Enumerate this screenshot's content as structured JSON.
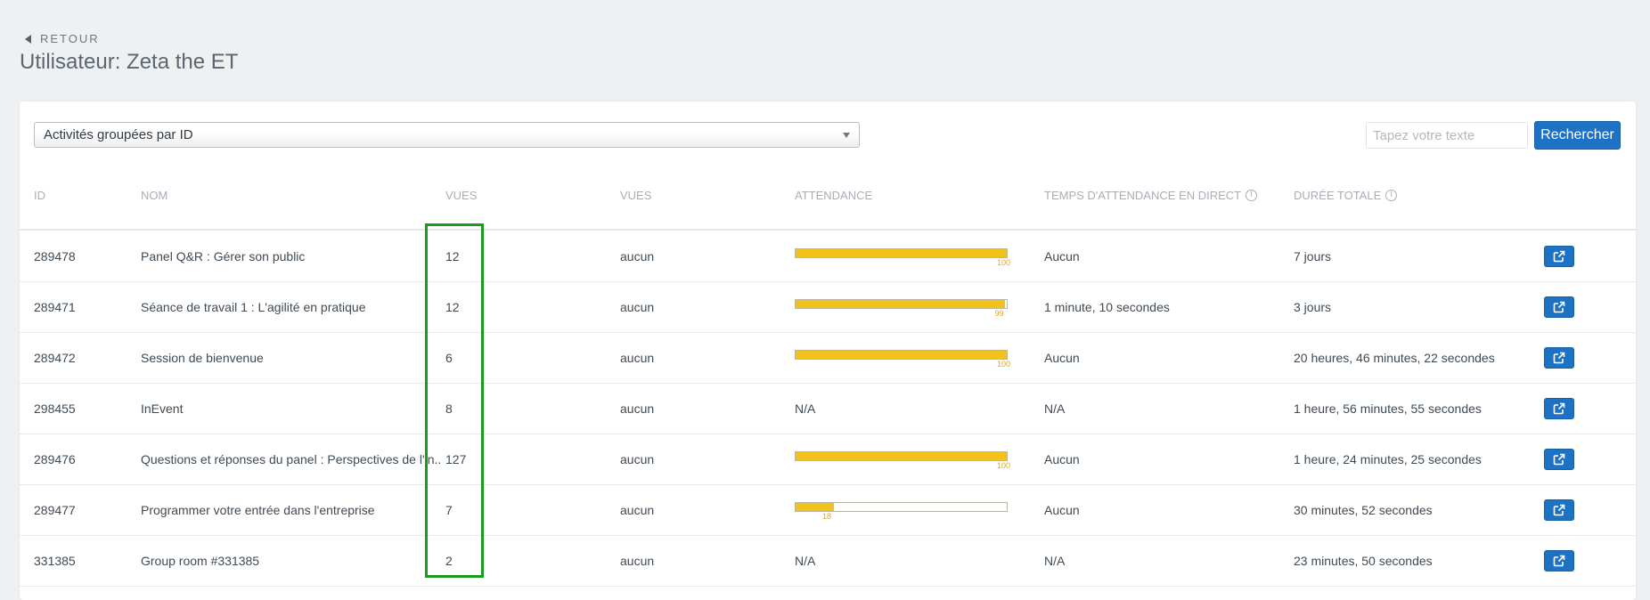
{
  "header": {
    "back_label": "RETOUR",
    "title": "Utilisateur: Zeta the ET"
  },
  "filters": {
    "group_select": "Activités groupées par ID",
    "search_placeholder": "Tapez votre texte",
    "search_button": "Rechercher"
  },
  "table": {
    "columns": [
      "ID",
      "NOM",
      "VUES",
      "VUES",
      "ATTENDANCE",
      "TEMPS D'ATTENDANCE EN DIRECT",
      "DURÉE TOTALE"
    ],
    "rows": [
      {
        "id": "289478",
        "nom": "Panel Q&R : Gérer son public",
        "vues": "12",
        "vues2": "aucun",
        "attendance": 100,
        "attendance_label": "100",
        "attendance_text": "",
        "temps": "Aucun",
        "duree": "7 jours"
      },
      {
        "id": "289471",
        "nom": "Séance de travail 1 : L'agilité en pratique",
        "vues": "12",
        "vues2": "aucun",
        "attendance": 99,
        "attendance_label": "99",
        "attendance_text": "",
        "temps": "1 minute, 10 secondes",
        "duree": "3 jours"
      },
      {
        "id": "289472",
        "nom": "Session de bienvenue",
        "vues": "6",
        "vues2": "aucun",
        "attendance": 100,
        "attendance_label": "100",
        "attendance_text": "",
        "temps": "Aucun",
        "duree": "20 heures, 46 minutes, 22 secondes"
      },
      {
        "id": "298455",
        "nom": "InEvent",
        "vues": "8",
        "vues2": "aucun",
        "attendance": null,
        "attendance_label": "",
        "attendance_text": "N/A",
        "temps": "N/A",
        "duree": "1 heure, 56 minutes, 55 secondes"
      },
      {
        "id": "289476",
        "nom": "Questions et réponses du panel : Perspectives de l'in...",
        "vues": "127",
        "vues2": "aucun",
        "attendance": 100,
        "attendance_label": "100",
        "attendance_text": "",
        "temps": "Aucun",
        "duree": "1 heure, 24 minutes, 25 secondes"
      },
      {
        "id": "289477",
        "nom": "Programmer votre entrée dans l'entreprise",
        "vues": "7",
        "vues2": "aucun",
        "attendance": 18,
        "attendance_label": "18",
        "attendance_text": "",
        "temps": "Aucun",
        "duree": "30 minutes, 52 secondes"
      },
      {
        "id": "331385",
        "nom": "Group room #331385",
        "vues": "2",
        "vues2": "aucun",
        "attendance": null,
        "attendance_label": "",
        "attendance_text": "N/A",
        "temps": "N/A",
        "duree": "23 minutes, 50 secondes"
      }
    ]
  },
  "colors": {
    "accent": "#1d72c4",
    "bar_fill": "#f2c21b",
    "highlight": "#1a9b1e"
  },
  "icons": {
    "back": "caret-left-icon",
    "select_arrow": "chevron-down-icon",
    "info": "info-circle-icon",
    "open": "external-link-icon"
  }
}
